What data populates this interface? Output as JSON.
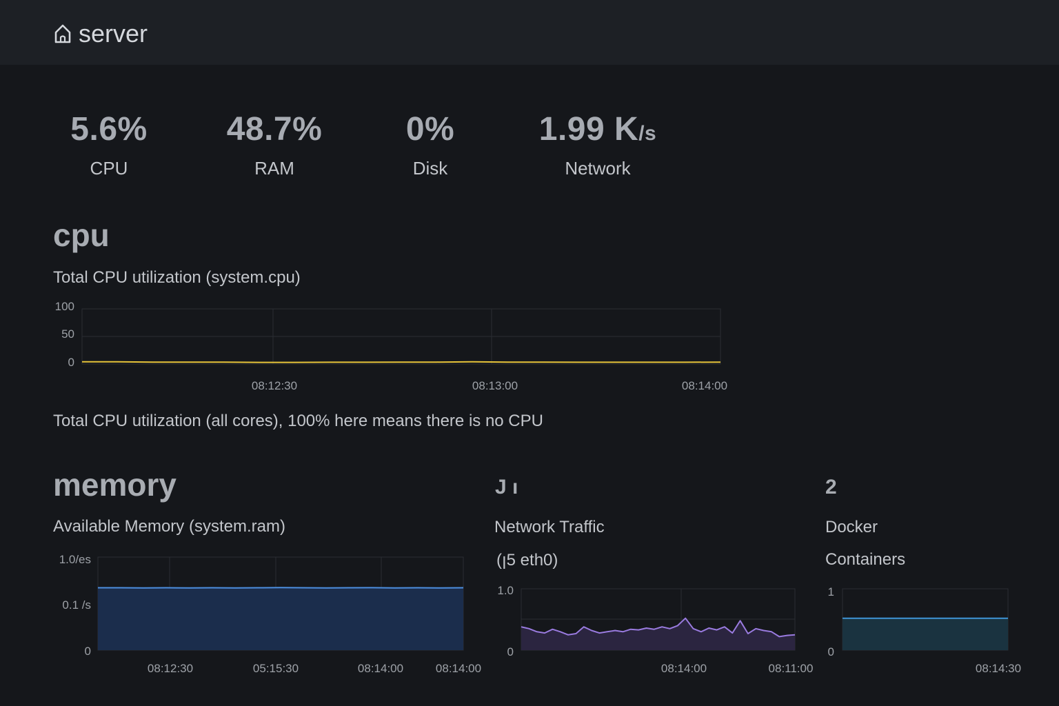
{
  "header": {
    "title": "server",
    "icon": "home-icon"
  },
  "stats": [
    {
      "value": "5.6%",
      "unit": "",
      "label": "CPU"
    },
    {
      "value": "48.7%",
      "unit": "",
      "label": "RAM"
    },
    {
      "value": "0%",
      "unit": "",
      "label": "Disk"
    },
    {
      "value": "1.99 K",
      "unit": "/s",
      "label": "Network"
    }
  ],
  "cpu": {
    "section_title": "cpu",
    "chart_title": "Total CPU utilization (system.cpu)",
    "note": "Total CPU utilization (all cores), 100% here means there is no CPU"
  },
  "memory": {
    "section_title": "memory",
    "chart_title": "Available Memory (system.ram)"
  },
  "network": {
    "section_glyph": "J ı",
    "chart_title": "Network Traffic",
    "chart_subtitle": "(ꞁ5 eth0)"
  },
  "docker": {
    "section_glyph": "2",
    "chart_title_line1": "Docker",
    "chart_title_line2": "Containers"
  },
  "colors": {
    "cpu_line": "#e8c53a",
    "mem_line": "#4d8fe0",
    "mem_fill": "#1b2d4c",
    "net_line": "#9a7be0",
    "net_fill": "#2b2540",
    "docker_line": "#3f94d6",
    "docker_fill": "#1a3340",
    "grid": "#2a2d33"
  },
  "chart_data": [
    {
      "type": "line",
      "ylim": [
        0,
        100
      ],
      "yticks": [
        "100",
        "50",
        "0"
      ],
      "xticks": [
        "08:12:30",
        "08:13:00",
        "08:14:00"
      ],
      "series": [
        {
          "values": [
            4,
            4,
            3.5,
            3.5,
            3.5,
            3,
            3,
            3.2,
            3.3,
            3.5,
            3.5,
            4,
            3.5,
            3.5,
            3.3,
            3.2,
            3.2,
            3.3,
            3.5
          ]
        }
      ]
    },
    {
      "type": "area",
      "ylim": [
        0,
        1
      ],
      "yticks": [
        "1.0/es",
        "0.1 /s",
        "0"
      ],
      "xticks": [
        "08:12:30",
        "05:15:30",
        "08:14:00",
        "08:14:00"
      ],
      "series": [
        {
          "values": [
            0.67,
            0.67,
            0.668,
            0.67,
            0.668,
            0.67,
            0.669,
            0.67,
            0.672,
            0.67,
            0.669,
            0.67,
            0.671,
            0.669,
            0.67,
            0.668,
            0.67
          ]
        }
      ]
    },
    {
      "type": "area",
      "ylim": [
        0,
        1
      ],
      "yticks": [
        "1.0",
        "0"
      ],
      "xticks": [
        "08:14:00",
        "08:11:00"
      ],
      "series": [
        {
          "values": [
            0.38,
            0.35,
            0.3,
            0.28,
            0.34,
            0.3,
            0.25,
            0.27,
            0.38,
            0.32,
            0.28,
            0.3,
            0.32,
            0.3,
            0.34,
            0.33,
            0.36,
            0.34,
            0.38,
            0.35,
            0.4,
            0.52,
            0.35,
            0.3,
            0.36,
            0.33,
            0.38,
            0.28,
            0.48,
            0.27,
            0.35,
            0.32,
            0.3,
            0.22,
            0.24,
            0.25
          ]
        }
      ]
    },
    {
      "type": "area",
      "ylim": [
        0,
        1
      ],
      "yticks": [
        "1",
        "0"
      ],
      "xticks": [
        "08:14:30"
      ],
      "series": [
        {
          "values": [
            0.52,
            0.52,
            0.52,
            0.52,
            0.52,
            0.52
          ]
        }
      ]
    }
  ]
}
